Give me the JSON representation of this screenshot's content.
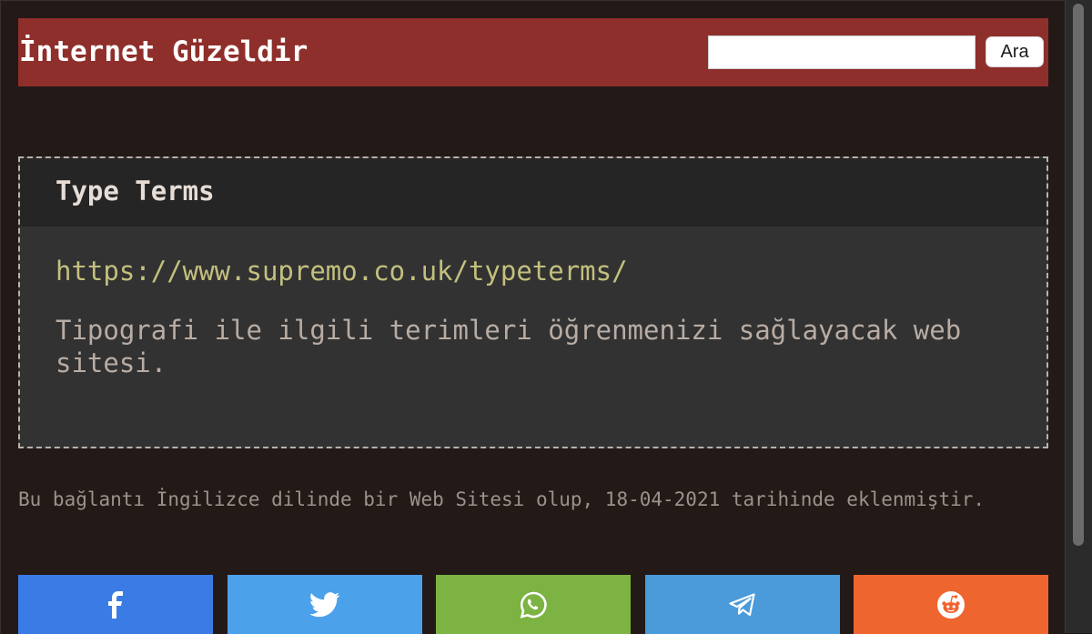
{
  "header": {
    "site_title": "İnternet Güzeldir",
    "search": {
      "value": "",
      "placeholder": ""
    },
    "search_button_label": "Ara"
  },
  "card": {
    "title": "Type Terms",
    "url": "https://www.supremo.co.uk/typeterms/",
    "description": "Tipografi ile ilgili terimleri öğrenmenizi sağlayacak web sitesi."
  },
  "note": "Bu bağlantı İngilizce dilinde bir Web Sitesi olup, 18-04-2021 tarihinde eklenmiştir.",
  "share": [
    {
      "name": "facebook",
      "icon": "facebook-icon",
      "color": "#3b7be6"
    },
    {
      "name": "twitter",
      "icon": "twitter-icon",
      "color": "#4ca1eb"
    },
    {
      "name": "whatsapp",
      "icon": "whatsapp-icon",
      "color": "#7cb342"
    },
    {
      "name": "telegram",
      "icon": "telegram-icon",
      "color": "#4b9ada"
    },
    {
      "name": "reddit",
      "icon": "reddit-icon",
      "color": "#ef6530"
    }
  ],
  "colors": {
    "page_background": "#231917",
    "header_background": "#8e2f2b",
    "card_background": "#323232",
    "link": "#c3c07e"
  }
}
